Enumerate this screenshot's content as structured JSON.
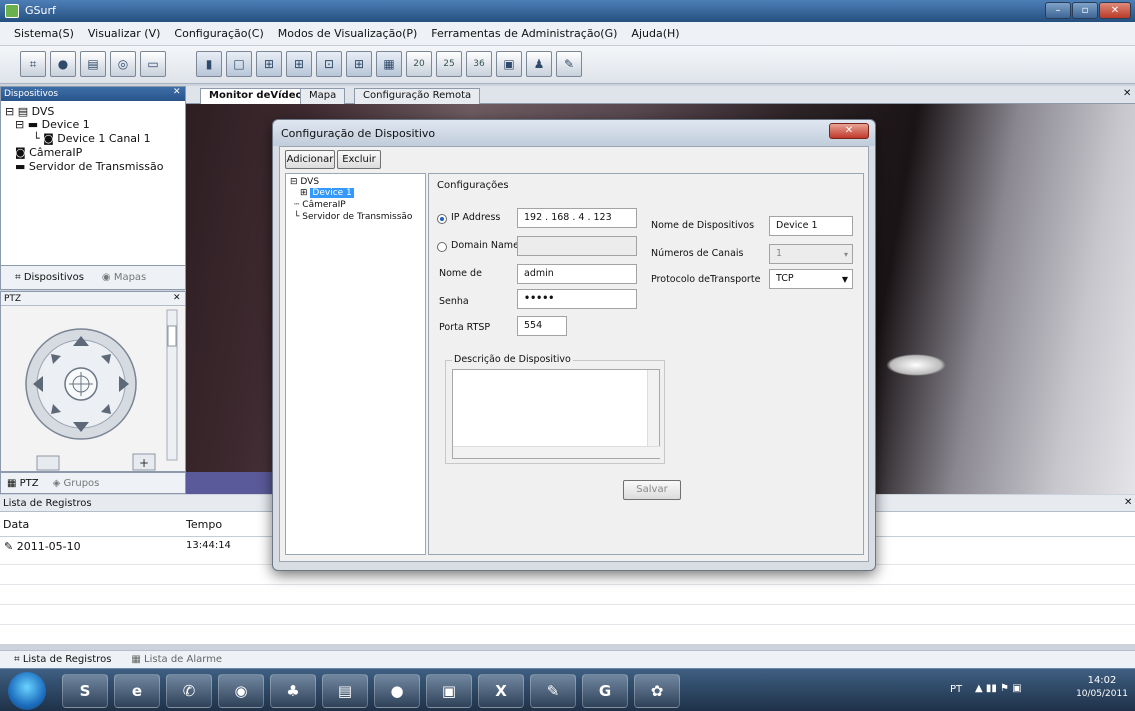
{
  "window": {
    "title": "GSurf"
  },
  "menu": [
    "Sistema(S)",
    "Visualizar (V)",
    "Configuração(C)",
    "Modos de Visualização(P)",
    "Ferramentas de Administração(G)",
    "Ajuda(H)"
  ],
  "toolbar": {
    "num_buttons": [
      "20",
      "25",
      "36"
    ]
  },
  "left_panel": {
    "title": "Dispositivos",
    "tree": [
      "DVS",
      "Device 1",
      "Device 1 Canal 1",
      "CâmeraIP",
      "Servidor de Transmissão"
    ],
    "tabs": [
      "Dispositivos",
      "Mapas"
    ],
    "ptz_title": "PTZ",
    "bottom_tabs": [
      "PTZ",
      "Grupos"
    ]
  },
  "video_tabs": [
    "Monitor deVídeo",
    "Mapa",
    "Configuração Remota"
  ],
  "log": {
    "title": "Lista de Registros",
    "columns": [
      "Data",
      "Tempo"
    ],
    "rows": [
      {
        "date": "2011-05-10",
        "time": "13:44:14"
      }
    ],
    "tabs": [
      "Lista de Registros",
      "Lista de Alarme"
    ]
  },
  "dialog": {
    "title": "Configuração de Dispositivo",
    "buttons": {
      "add": "Adicionar",
      "delete": "Excluir",
      "save": "Salvar"
    },
    "tree": {
      "root": "DVS",
      "selected": "Device 1",
      "camera": "CâmeraIP",
      "server": "Servidor de Transmissão"
    },
    "config": {
      "heading": "Configurações",
      "ip_label": "IP Address",
      "ip_value": "192 . 168 . 4 . 123",
      "domain_label": "Domain Name",
      "domain_value": "",
      "user_label": "Nome de",
      "user_value": "admin",
      "password_label": "Senha",
      "password_value": "•••••",
      "rtsp_label": "Porta RTSP",
      "rtsp_value": "554",
      "device_name_label": "Nome de Dispositivos",
      "device_name_value": "Device 1",
      "channels_label": "Números de Canais",
      "channels_value": "1",
      "protocol_label": "Protocolo deTransporte",
      "protocol_value": "TCP",
      "description_label": "Descrição de Dispositivo"
    }
  },
  "taskbar": {
    "lang": "PT",
    "time": "14:02",
    "date": "10/05/2011"
  }
}
